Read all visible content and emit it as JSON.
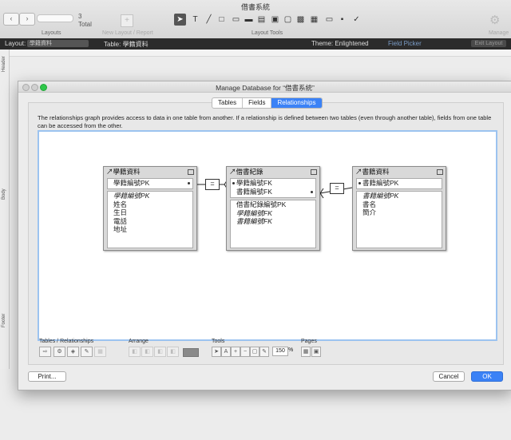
{
  "window_title": "借書系統",
  "toolbar": {
    "record_number": "3",
    "record_total": "Total",
    "layouts_label": "Layouts",
    "new_layout_label": "New Layout / Report",
    "layout_tools_label": "Layout Tools",
    "manage_label": "Manage",
    "prev_icon": "chevron-left-icon",
    "next_icon": "chevron-right-icon"
  },
  "layout_bar": {
    "layout_label": "Layout:",
    "layout_value": "學籍資料",
    "table_label": "Table: 學籍資料",
    "theme_label": "Theme: Enlightened",
    "field_picker": "Field Picker",
    "exit_layout": "Exit Layout"
  },
  "parts": {
    "header": "Header",
    "body": "Body",
    "footer": "Footer"
  },
  "dialog": {
    "title": "Manage Database for “借書系統”",
    "tabs": [
      {
        "label": "Tables",
        "active": false
      },
      {
        "label": "Fields",
        "active": false
      },
      {
        "label": "Relationships",
        "active": true
      }
    ],
    "description": "The relationships graph provides access to data in one table from another. If a relationship is defined between two tables (even through another table), fields from one table can be accessed from the other.",
    "tables": [
      {
        "name": "學籍資料",
        "keys": [
          "學籍編號PK"
        ],
        "fields": [
          {
            "name": "學籍編號PK",
            "italic": true
          },
          {
            "name": "姓名",
            "italic": false
          },
          {
            "name": "生日",
            "italic": false
          },
          {
            "name": "電話",
            "italic": false
          },
          {
            "name": "地址",
            "italic": false
          }
        ]
      },
      {
        "name": "借書紀錄",
        "keys": [
          "學籍編號FK",
          "書籍編號FK"
        ],
        "fields": [
          {
            "name": "借書紀錄編號PK",
            "italic": false
          },
          {
            "name": "學籍編號FK",
            "italic": true
          },
          {
            "name": "書籍編號FK",
            "italic": true
          }
        ]
      },
      {
        "name": "書籍資料",
        "keys": [
          "書籍編號PK"
        ],
        "fields": [
          {
            "name": "書籍編號PK",
            "italic": true
          },
          {
            "name": "書名",
            "italic": false
          },
          {
            "name": "簡介",
            "italic": false
          }
        ]
      }
    ],
    "bottom": {
      "tables_relationships_label": "Tables / Relationships",
      "arrange_label": "Arrange",
      "tools_label": "Tools",
      "zoom_value": "150",
      "zoom_unit": "%",
      "pages_label": "Pages"
    },
    "buttons": {
      "print": "Print...",
      "cancel": "Cancel",
      "ok": "OK"
    }
  },
  "colors": {
    "accent": "#3b82f6",
    "selection_border": "#9cc3f0"
  }
}
